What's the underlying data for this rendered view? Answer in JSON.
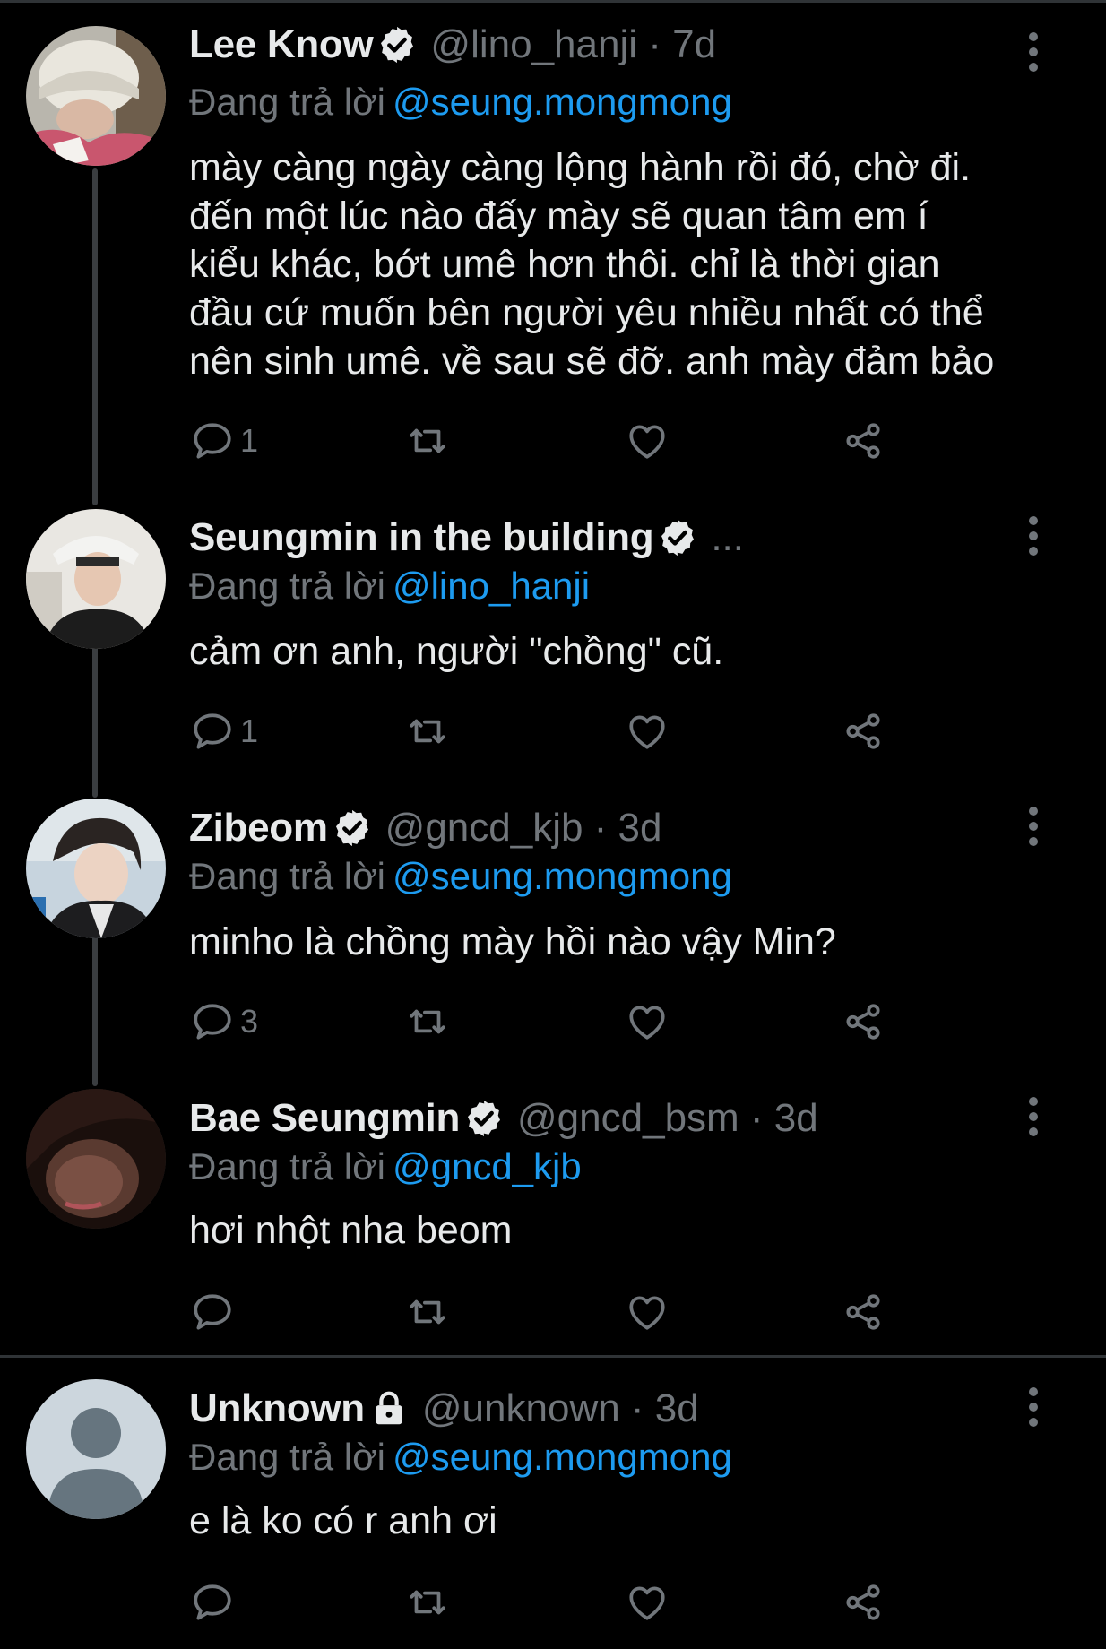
{
  "colors": {
    "background": "#000000",
    "text": "#e7e9ea",
    "muted": "#71767b",
    "accent": "#1d9bf0"
  },
  "tweets": [
    {
      "name": "Lee Know",
      "badge_icon": "verified-badge-icon",
      "handle_time": "@lino_hanji · 7d",
      "replying_label": "Đang trả lời",
      "replying_to": "@seung.mongmong",
      "text": "mày càng ngày càng lộng hành rồi đó, chờ đi.\nđến một lúc nào đấy mày sẽ quan tâm em í\nkiểu khác, bớt umê hơn thôi. chỉ là thời gian\nđầu cứ muốn bên người yêu nhiều nhất có thể\nnên sinh umê. về sau sẽ đỡ. anh mày đảm bảo",
      "reply_count": "1"
    },
    {
      "name": "Seungmin in the building",
      "badge_icon": "verified-badge-icon",
      "handle_time": "...",
      "replying_label": "Đang trả lời",
      "replying_to": "@lino_hanji",
      "text": "cảm ơn anh, người \"chồng\" cũ.",
      "reply_count": "1"
    },
    {
      "name": "Zibeom",
      "badge_icon": "verified-badge-icon",
      "handle_time": "@gncd_kjb · 3d",
      "replying_label": "Đang trả lời",
      "replying_to": "@seung.mongmong",
      "text": "minho là chồng mày hồi nào vậy Min?",
      "reply_count": "3"
    },
    {
      "name": "Bae Seungmin",
      "badge_icon": "verified-badge-icon",
      "handle_time": "@gncd_bsm · 3d",
      "replying_label": "Đang trả lời",
      "replying_to": "@gncd_kjb",
      "text": "hơi nhột nha beom",
      "reply_count": ""
    },
    {
      "name": "Unknown",
      "badge_icon": "lock-icon",
      "handle_time": "@unknown · 3d",
      "replying_label": "Đang trả lời",
      "replying_to": "@seung.mongmong",
      "text": "e là ko có r anh ơi",
      "reply_count": ""
    }
  ]
}
